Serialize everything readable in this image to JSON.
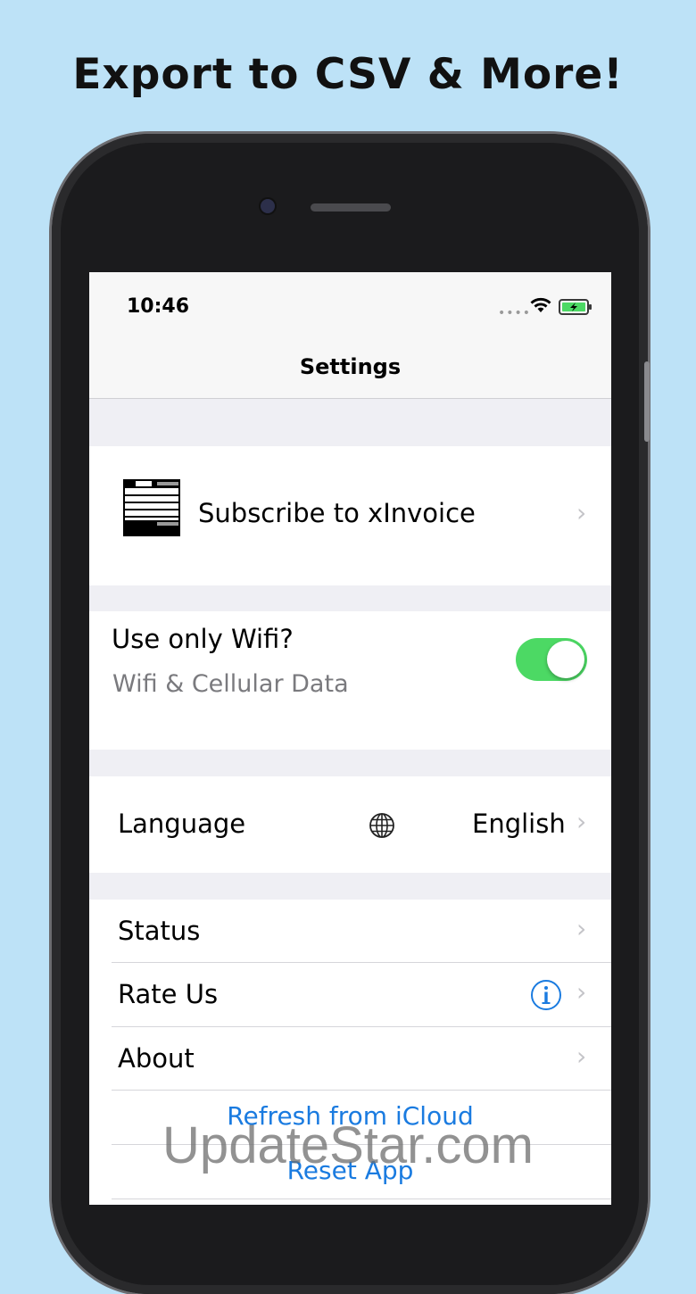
{
  "headline": "Export to CSV & More!",
  "status_bar": {
    "time": "10:46"
  },
  "nav": {
    "title": "Settings"
  },
  "subscribe": {
    "label": "Subscribe to xInvoice"
  },
  "wifi_setting": {
    "title": "Use only Wifi?",
    "subtitle": "Wifi & Cellular Data",
    "toggle_on": true
  },
  "language": {
    "label": "Language",
    "value": "English"
  },
  "menu": {
    "status": "Status",
    "rate_us": "Rate Us",
    "about": "About",
    "refresh": "Refresh from iCloud",
    "reset": "Reset App"
  },
  "watermark": "UpdateStar.com",
  "colors": {
    "background": "#bde2f7",
    "toggle": "#4cd964",
    "link": "#1a7be0"
  },
  "icons": [
    "wifi-icon",
    "battery-icon",
    "invoice-logo-icon",
    "chevron-right-icon",
    "globe-icon",
    "info-icon"
  ]
}
